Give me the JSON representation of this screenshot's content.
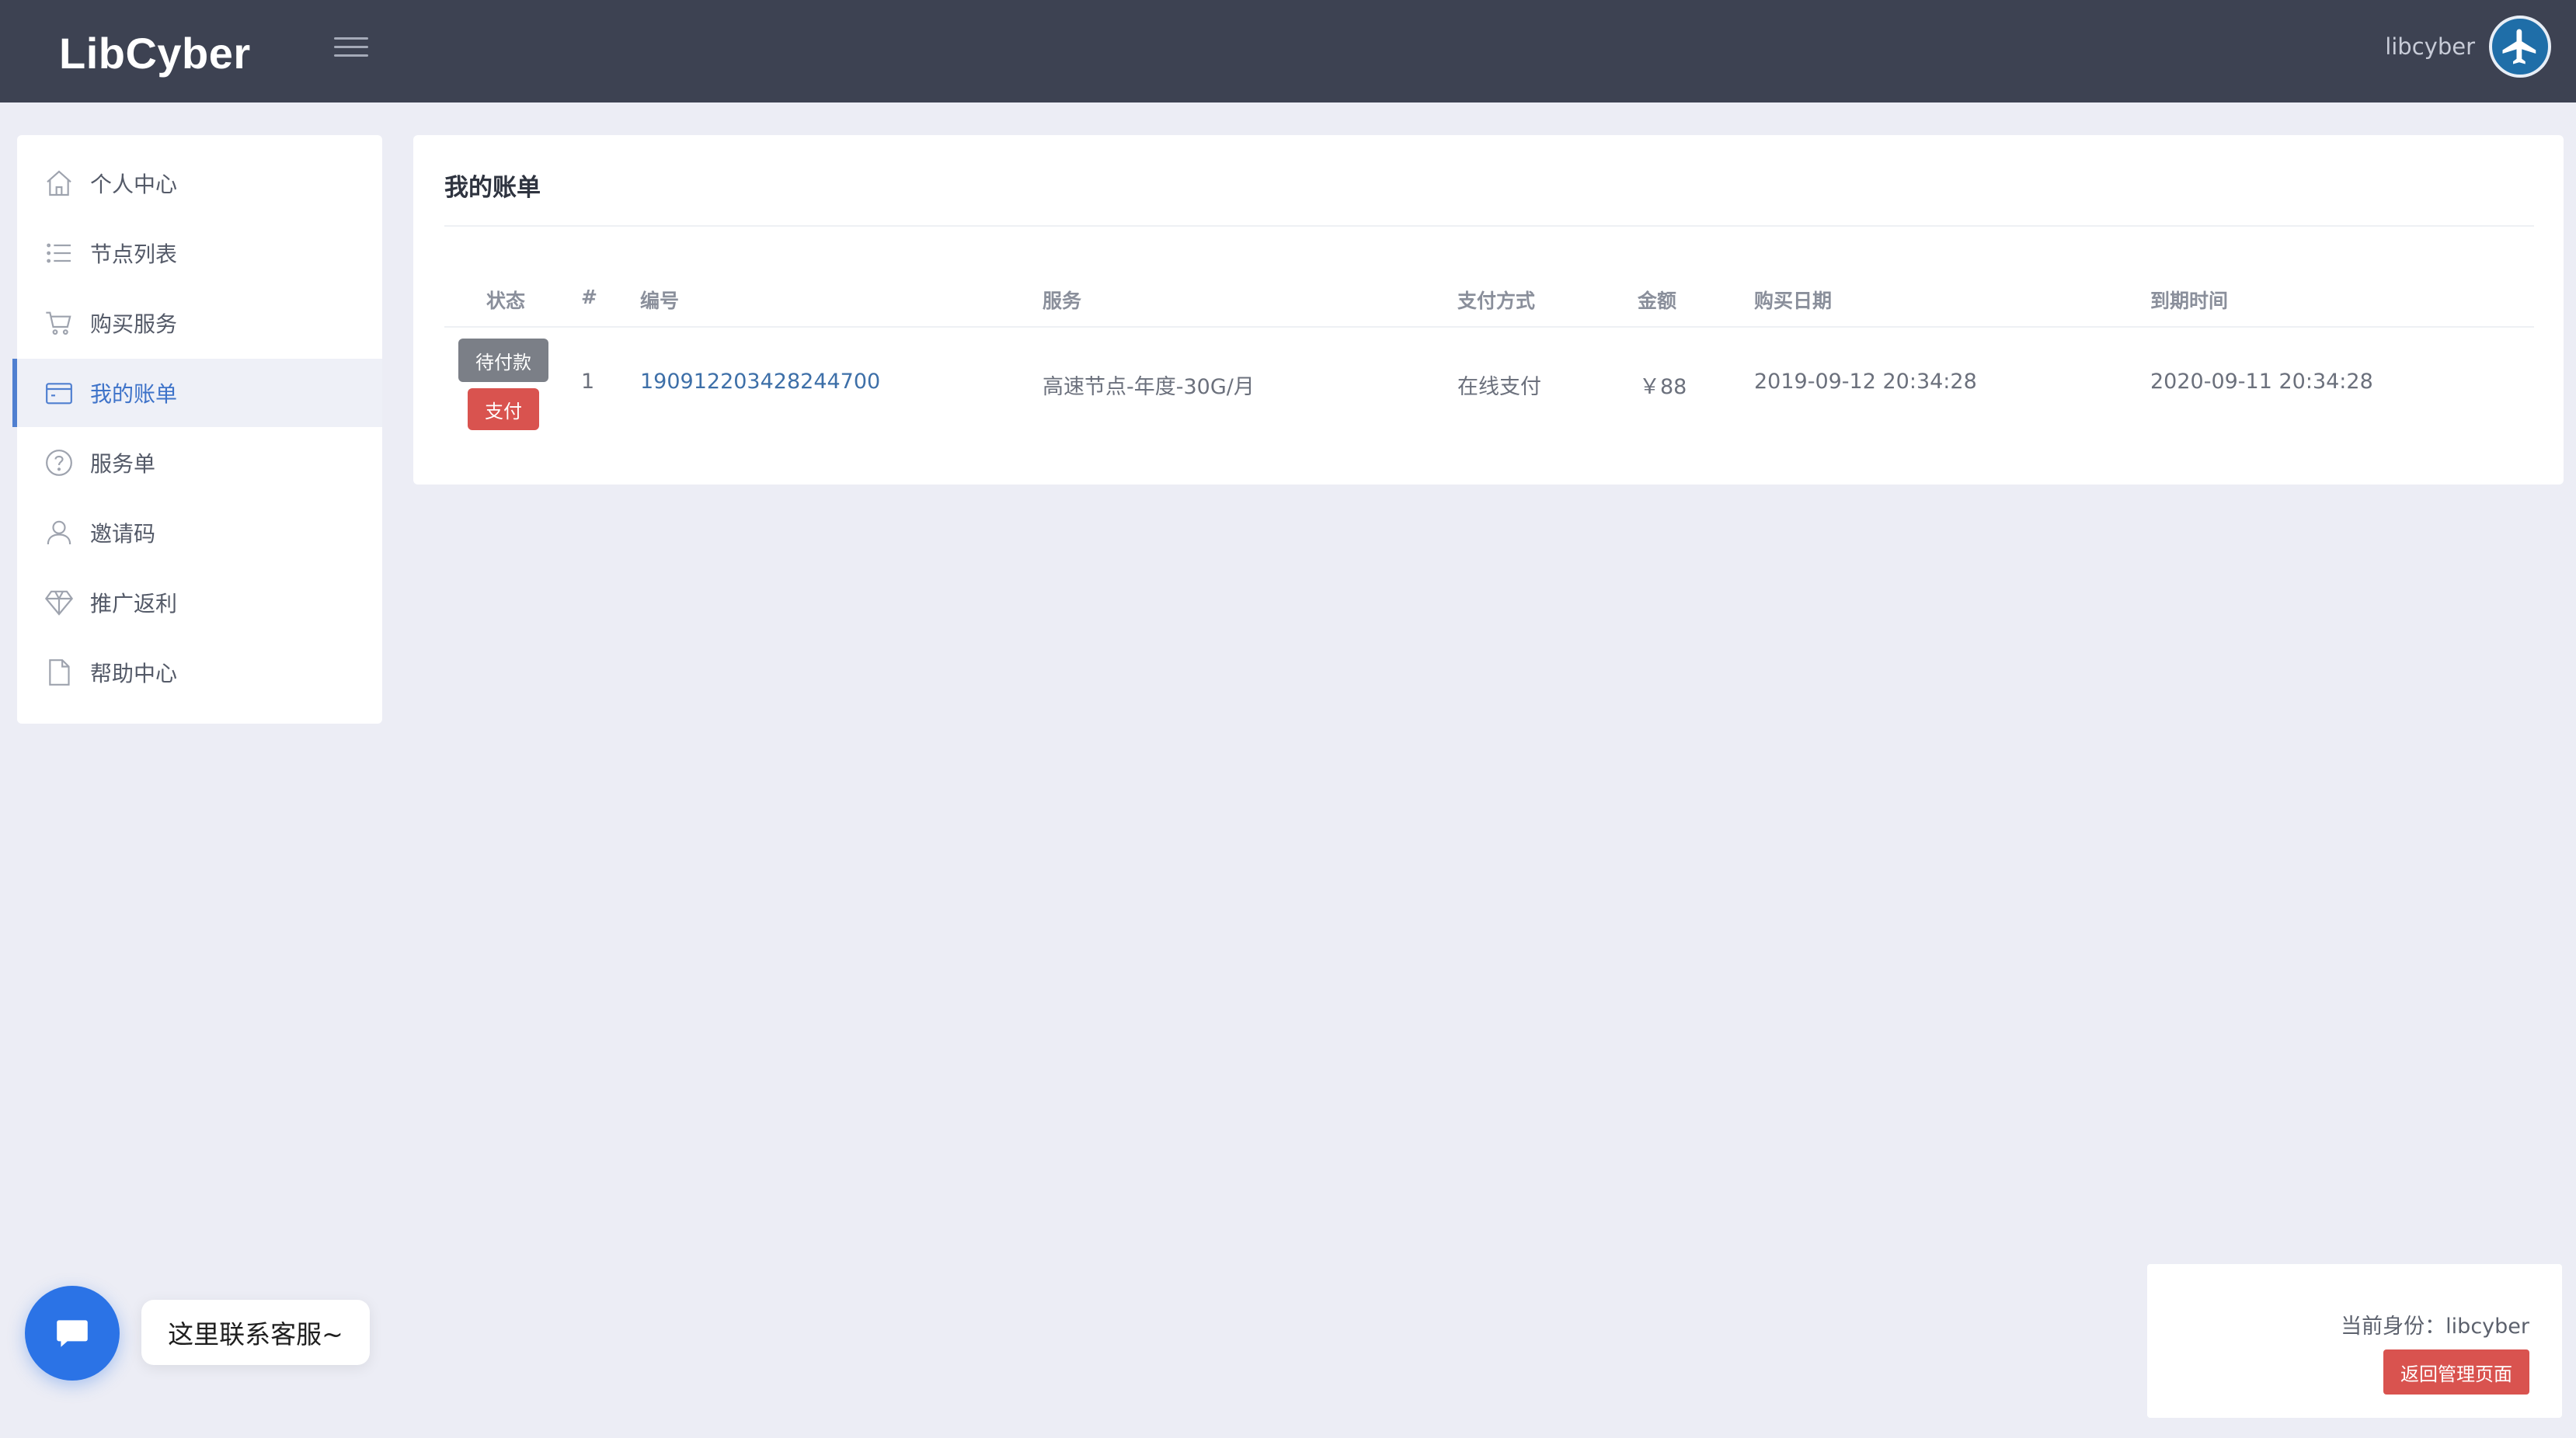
{
  "header": {
    "brand": "LibCyber",
    "username": "libcyber"
  },
  "sidebar": {
    "items": [
      {
        "label": "个人中心",
        "icon": "home-icon"
      },
      {
        "label": "节点列表",
        "icon": "list-icon"
      },
      {
        "label": "购买服务",
        "icon": "cart-icon"
      },
      {
        "label": "我的账单",
        "icon": "wallet-icon",
        "active": true
      },
      {
        "label": "服务单",
        "icon": "question-icon"
      },
      {
        "label": "邀请码",
        "icon": "user-icon"
      },
      {
        "label": "推广返利",
        "icon": "diamond-icon"
      },
      {
        "label": "帮助中心",
        "icon": "document-icon"
      }
    ]
  },
  "main": {
    "title": "我的账单",
    "table": {
      "headers": [
        "状态",
        "#",
        "编号",
        "服务",
        "支付方式",
        "金额",
        "购买日期",
        "到期时间"
      ],
      "rows": [
        {
          "status": "待付款",
          "action": "支付",
          "index": "1",
          "order_no": "190912203428244700",
          "service": "高速节点-年度-30G/月",
          "payment": "在线支付",
          "amount": "￥88",
          "purchase_date": "2019-09-12 20:34:28",
          "expire_date": "2020-09-11 20:34:28"
        }
      ]
    }
  },
  "chat": {
    "bubble_text": "这里联系客服~"
  },
  "identity": {
    "text": "当前身份：libcyber",
    "return_button": "返回管理页面"
  },
  "colors": {
    "topbar": "#3d4252",
    "accent": "#3e73c9",
    "danger": "#d9534f",
    "background": "#ecedf5"
  }
}
